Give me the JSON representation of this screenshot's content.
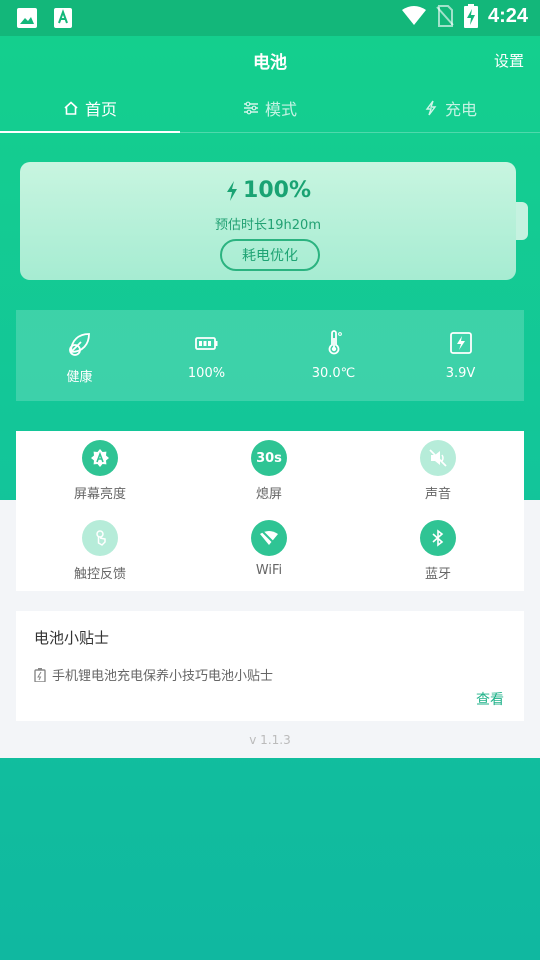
{
  "status_bar": {
    "time": "4:24",
    "icons": [
      "image-icon",
      "font-a-icon",
      "wifi-icon",
      "no-sim-icon",
      "battery-charging-icon"
    ]
  },
  "appbar": {
    "title": "电池",
    "settings": "设置"
  },
  "tabs": [
    {
      "label": "首页",
      "icon": "home-icon",
      "active": true
    },
    {
      "label": "模式",
      "icon": "sliders-icon",
      "active": false
    },
    {
      "label": "充电",
      "icon": "bolt-icon",
      "active": false
    }
  ],
  "battery": {
    "percent": "100%",
    "estimate": "预估时长19h20m",
    "optimize_label": "耗电优化"
  },
  "stats": [
    {
      "icon": "leaf-icon",
      "value": "健康"
    },
    {
      "icon": "battery-icon",
      "value": "100%"
    },
    {
      "icon": "thermometer-icon",
      "value": "30.0℃"
    },
    {
      "icon": "voltage-icon",
      "value": "3.9V"
    }
  ],
  "quick_settings": [
    {
      "label": "屏幕亮度",
      "icon": "brightness-icon",
      "state": "on"
    },
    {
      "label": "熄屏",
      "text": "30s",
      "state": "on"
    },
    {
      "label": "声音",
      "icon": "sound-off-icon",
      "state": "off"
    },
    {
      "label": "触控反馈",
      "icon": "touch-icon",
      "state": "off"
    },
    {
      "label": "WiFi",
      "icon": "wifi-off-icon",
      "state": "on"
    },
    {
      "label": "蓝牙",
      "icon": "bluetooth-icon",
      "state": "on"
    }
  ],
  "tips": {
    "title": "电池小贴士",
    "item": "手机锂电池充电保养小技巧电池小贴士",
    "view_label": "查看"
  },
  "version": "v 1.1.3",
  "colors": {
    "primary": "#14d08c",
    "accent_text": "#1fa474",
    "icon_on": "#2fc494",
    "icon_off": "#b6ecd9"
  }
}
